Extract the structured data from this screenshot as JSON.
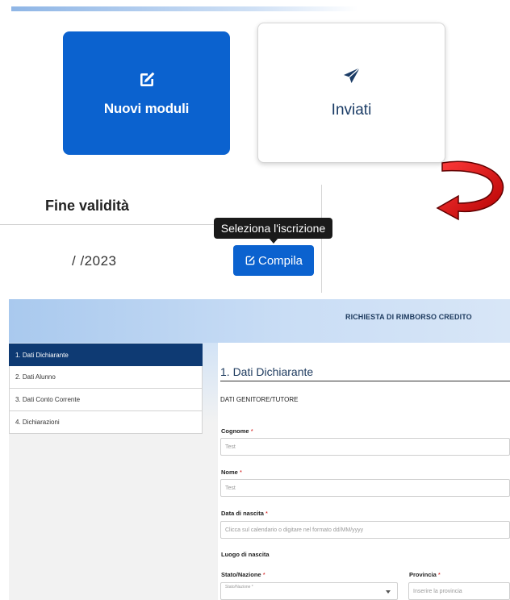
{
  "cards": {
    "new_label": "Nuovi moduli",
    "new_icon": "edit-icon",
    "sent_label": "Inviati",
    "sent_icon": "paper-plane-icon"
  },
  "table": {
    "header": "Fine validità",
    "date_value": "/ /2023",
    "tooltip": "Seleziona l'iscrizione",
    "action_label": "Compila",
    "action_icon": "edit-icon"
  },
  "annotation": {
    "arrow_color": "#e00000",
    "arrow_icon": "curved-arrow-icon"
  },
  "form_page": {
    "header_title": "RICHIESTA DI RIMBORSO CREDITO",
    "steps": [
      "1. Dati Dichiarante",
      "2. Dati Alunno",
      "3. Dati Conto Corrente",
      "4. Dichiarazioni"
    ],
    "active_step": 0,
    "title": "1. Dati Dichiarante",
    "section": "DATI GENITORE/TUTORE",
    "fields": {
      "cognome": {
        "label": "Cognome",
        "value": "Test"
      },
      "nome": {
        "label": "Nome",
        "value": "Test"
      },
      "data_nascita": {
        "label": "Data di nascita",
        "placeholder": "Clicca sul calendario o digitare nel formato dd/MM/yyyy"
      },
      "luogo_heading": "Luogo di nascita",
      "stato": {
        "label": "Stato/Nazione",
        "inner_label": "Stato/Nazione *"
      },
      "provincia": {
        "label": "Provincia",
        "placeholder": "Inserire la provincia"
      }
    },
    "required_mark": "*"
  },
  "colors": {
    "primary": "#0b62cf",
    "nav_active": "#0e3a73",
    "heading": "#1d3a5e"
  }
}
